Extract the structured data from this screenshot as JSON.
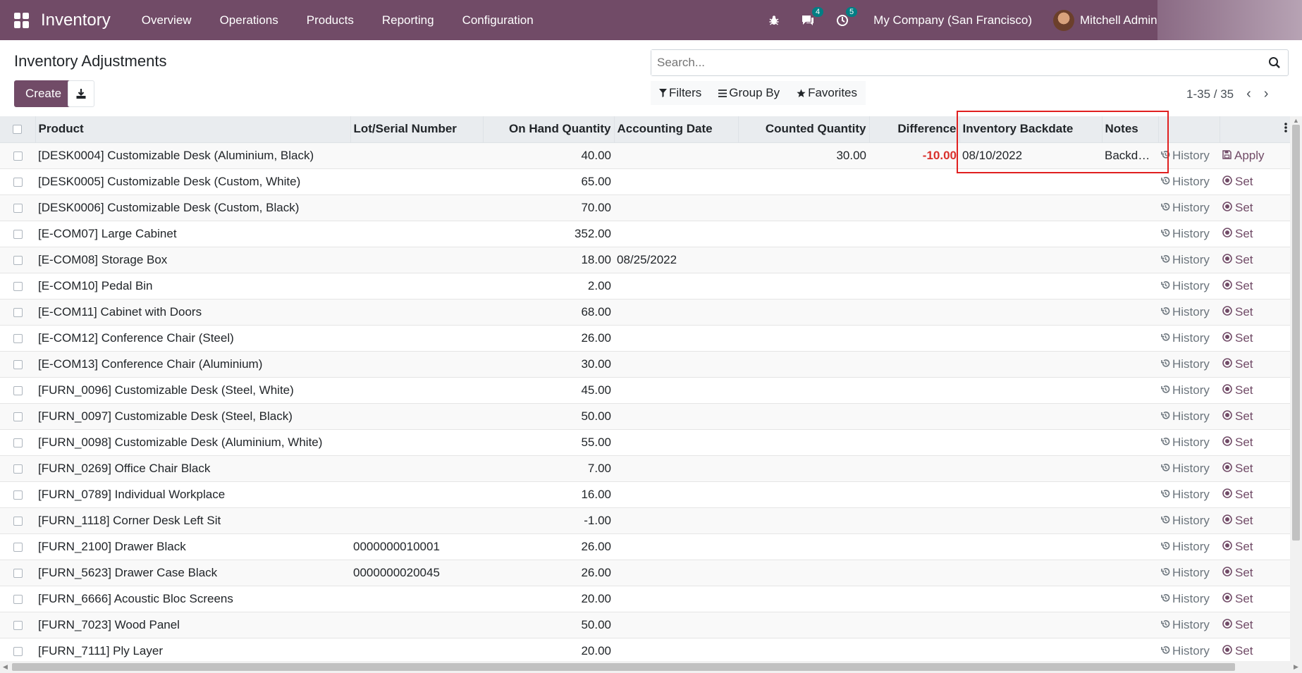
{
  "navbar": {
    "brand": "Inventory",
    "menu": [
      "Overview",
      "Operations",
      "Products",
      "Reporting",
      "Configuration"
    ],
    "chat_badge": "4",
    "activity_badge": "5",
    "company": "My Company (San Francisco)",
    "user": "Mitchell Admin",
    "colors": {
      "primary": "#714b67",
      "badge": "#017e84"
    }
  },
  "control": {
    "title": "Inventory Adjustments",
    "create_label": "Create",
    "search_placeholder": "Search...",
    "filters_label": "Filters",
    "groupby_label": "Group By",
    "favorites_label": "Favorites",
    "pager": "1-35 / 35"
  },
  "table": {
    "columns": [
      "Product",
      "Lot/Serial Number",
      "On Hand Quantity",
      "Accounting Date",
      "Counted Quantity",
      "Difference",
      "Inventory Backdate",
      "Notes"
    ],
    "history_label": "History",
    "set_label": "Set",
    "apply_label": "Apply",
    "rows": [
      {
        "product": "[DESK0004] Customizable Desk (Aluminium, Black)",
        "lot": "",
        "onhand": "40.00",
        "acc_date": "",
        "counted": "30.00",
        "diff": "-10.00",
        "backdate": "08/10/2022",
        "notes": "Backdate inventory",
        "action": "Apply"
      },
      {
        "product": "[DESK0005] Customizable Desk (Custom, White)",
        "lot": "",
        "onhand": "65.00",
        "acc_date": "",
        "counted": "",
        "diff": "",
        "backdate": "",
        "notes": "",
        "action": "Set"
      },
      {
        "product": "[DESK0006] Customizable Desk (Custom, Black)",
        "lot": "",
        "onhand": "70.00",
        "acc_date": "",
        "counted": "",
        "diff": "",
        "backdate": "",
        "notes": "",
        "action": "Set"
      },
      {
        "product": "[E-COM07] Large Cabinet",
        "lot": "",
        "onhand": "352.00",
        "acc_date": "",
        "counted": "",
        "diff": "",
        "backdate": "",
        "notes": "",
        "action": "Set"
      },
      {
        "product": "[E-COM08] Storage Box",
        "lot": "",
        "onhand": "18.00",
        "acc_date": "08/25/2022",
        "counted": "",
        "diff": "",
        "backdate": "",
        "notes": "",
        "action": "Set"
      },
      {
        "product": "[E-COM10] Pedal Bin",
        "lot": "",
        "onhand": "2.00",
        "acc_date": "",
        "counted": "",
        "diff": "",
        "backdate": "",
        "notes": "",
        "action": "Set"
      },
      {
        "product": "[E-COM11] Cabinet with Doors",
        "lot": "",
        "onhand": "68.00",
        "acc_date": "",
        "counted": "",
        "diff": "",
        "backdate": "",
        "notes": "",
        "action": "Set"
      },
      {
        "product": "[E-COM12] Conference Chair (Steel)",
        "lot": "",
        "onhand": "26.00",
        "acc_date": "",
        "counted": "",
        "diff": "",
        "backdate": "",
        "notes": "",
        "action": "Set"
      },
      {
        "product": "[E-COM13] Conference Chair (Aluminium)",
        "lot": "",
        "onhand": "30.00",
        "acc_date": "",
        "counted": "",
        "diff": "",
        "backdate": "",
        "notes": "",
        "action": "Set"
      },
      {
        "product": "[FURN_0096] Customizable Desk (Steel, White)",
        "lot": "",
        "onhand": "45.00",
        "acc_date": "",
        "counted": "",
        "diff": "",
        "backdate": "",
        "notes": "",
        "action": "Set"
      },
      {
        "product": "[FURN_0097] Customizable Desk (Steel, Black)",
        "lot": "",
        "onhand": "50.00",
        "acc_date": "",
        "counted": "",
        "diff": "",
        "backdate": "",
        "notes": "",
        "action": "Set"
      },
      {
        "product": "[FURN_0098] Customizable Desk (Aluminium, White)",
        "lot": "",
        "onhand": "55.00",
        "acc_date": "",
        "counted": "",
        "diff": "",
        "backdate": "",
        "notes": "",
        "action": "Set"
      },
      {
        "product": "[FURN_0269] Office Chair Black",
        "lot": "",
        "onhand": "7.00",
        "acc_date": "",
        "counted": "",
        "diff": "",
        "backdate": "",
        "notes": "",
        "action": "Set"
      },
      {
        "product": "[FURN_0789] Individual Workplace",
        "lot": "",
        "onhand": "16.00",
        "acc_date": "",
        "counted": "",
        "diff": "",
        "backdate": "",
        "notes": "",
        "action": "Set"
      },
      {
        "product": "[FURN_1118] Corner Desk Left Sit",
        "lot": "",
        "onhand": "-1.00",
        "acc_date": "",
        "counted": "",
        "diff": "",
        "backdate": "",
        "notes": "",
        "action": "Set"
      },
      {
        "product": "[FURN_2100] Drawer Black",
        "lot": "0000000010001",
        "onhand": "26.00",
        "acc_date": "",
        "counted": "",
        "diff": "",
        "backdate": "",
        "notes": "",
        "action": "Set"
      },
      {
        "product": "[FURN_5623] Drawer Case Black",
        "lot": "0000000020045",
        "onhand": "26.00",
        "acc_date": "",
        "counted": "",
        "diff": "",
        "backdate": "",
        "notes": "",
        "action": "Set"
      },
      {
        "product": "[FURN_6666] Acoustic Bloc Screens",
        "lot": "",
        "onhand": "20.00",
        "acc_date": "",
        "counted": "",
        "diff": "",
        "backdate": "",
        "notes": "",
        "action": "Set"
      },
      {
        "product": "[FURN_7023] Wood Panel",
        "lot": "",
        "onhand": "50.00",
        "acc_date": "",
        "counted": "",
        "diff": "",
        "backdate": "",
        "notes": "",
        "action": "Set"
      },
      {
        "product": "[FURN_7111] Ply Layer",
        "lot": "",
        "onhand": "20.00",
        "acc_date": "",
        "counted": "",
        "diff": "",
        "backdate": "",
        "notes": "",
        "action": "Set"
      }
    ]
  }
}
